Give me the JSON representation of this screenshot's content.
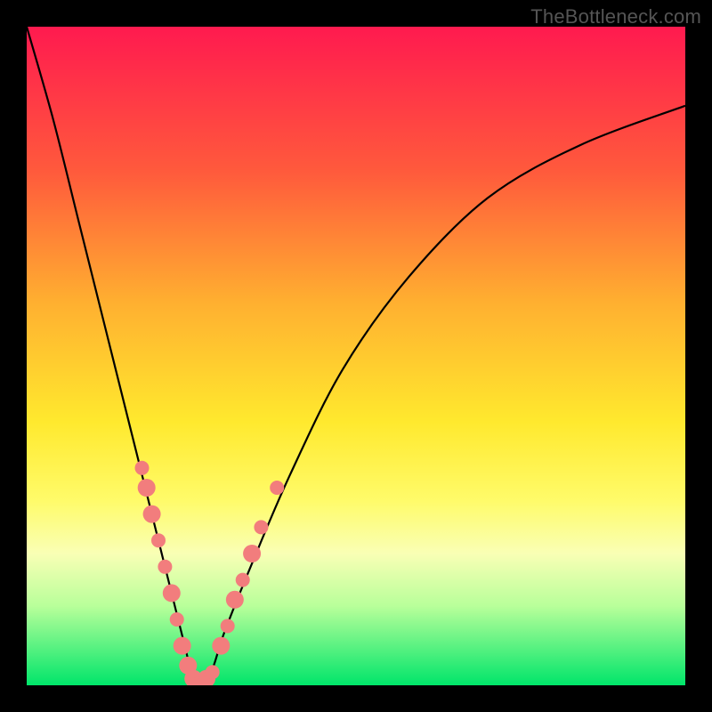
{
  "watermark": "TheBottleneck.com",
  "chart_data": {
    "type": "line",
    "title": "",
    "xlabel": "",
    "ylabel": "",
    "xlim": [
      0,
      100
    ],
    "ylim": [
      0,
      100
    ],
    "grid": false,
    "legend": false,
    "series": [
      {
        "name": "bottleneck-curve",
        "x": [
          0,
          4,
          8,
          12,
          16,
          18,
          20,
          22,
          24,
          25,
          26,
          28,
          30,
          34,
          40,
          48,
          58,
          70,
          84,
          100
        ],
        "y": [
          100,
          86,
          70,
          54,
          38,
          30,
          22,
          14,
          6,
          2,
          0,
          2,
          8,
          18,
          32,
          48,
          62,
          74,
          82,
          88
        ]
      }
    ],
    "points": {
      "name": "highlighted-dots",
      "color": "#f27d7d",
      "radius_default": 8,
      "items": [
        {
          "x": 17.5,
          "y": 33,
          "r": 8
        },
        {
          "x": 18.2,
          "y": 30,
          "r": 10
        },
        {
          "x": 19.0,
          "y": 26,
          "r": 10
        },
        {
          "x": 20.0,
          "y": 22,
          "r": 8
        },
        {
          "x": 21.0,
          "y": 18,
          "r": 8
        },
        {
          "x": 22.0,
          "y": 14,
          "r": 10
        },
        {
          "x": 22.8,
          "y": 10,
          "r": 8
        },
        {
          "x": 23.6,
          "y": 6,
          "r": 10
        },
        {
          "x": 24.5,
          "y": 3,
          "r": 10
        },
        {
          "x": 25.3,
          "y": 1,
          "r": 10
        },
        {
          "x": 26.2,
          "y": 0,
          "r": 10
        },
        {
          "x": 27.3,
          "y": 1,
          "r": 10
        },
        {
          "x": 28.2,
          "y": 2,
          "r": 8
        },
        {
          "x": 29.5,
          "y": 6,
          "r": 10
        },
        {
          "x": 30.5,
          "y": 9,
          "r": 8
        },
        {
          "x": 31.6,
          "y": 13,
          "r": 10
        },
        {
          "x": 32.8,
          "y": 16,
          "r": 8
        },
        {
          "x": 34.2,
          "y": 20,
          "r": 10
        },
        {
          "x": 35.6,
          "y": 24,
          "r": 8
        },
        {
          "x": 38.0,
          "y": 30,
          "r": 8
        }
      ]
    }
  }
}
